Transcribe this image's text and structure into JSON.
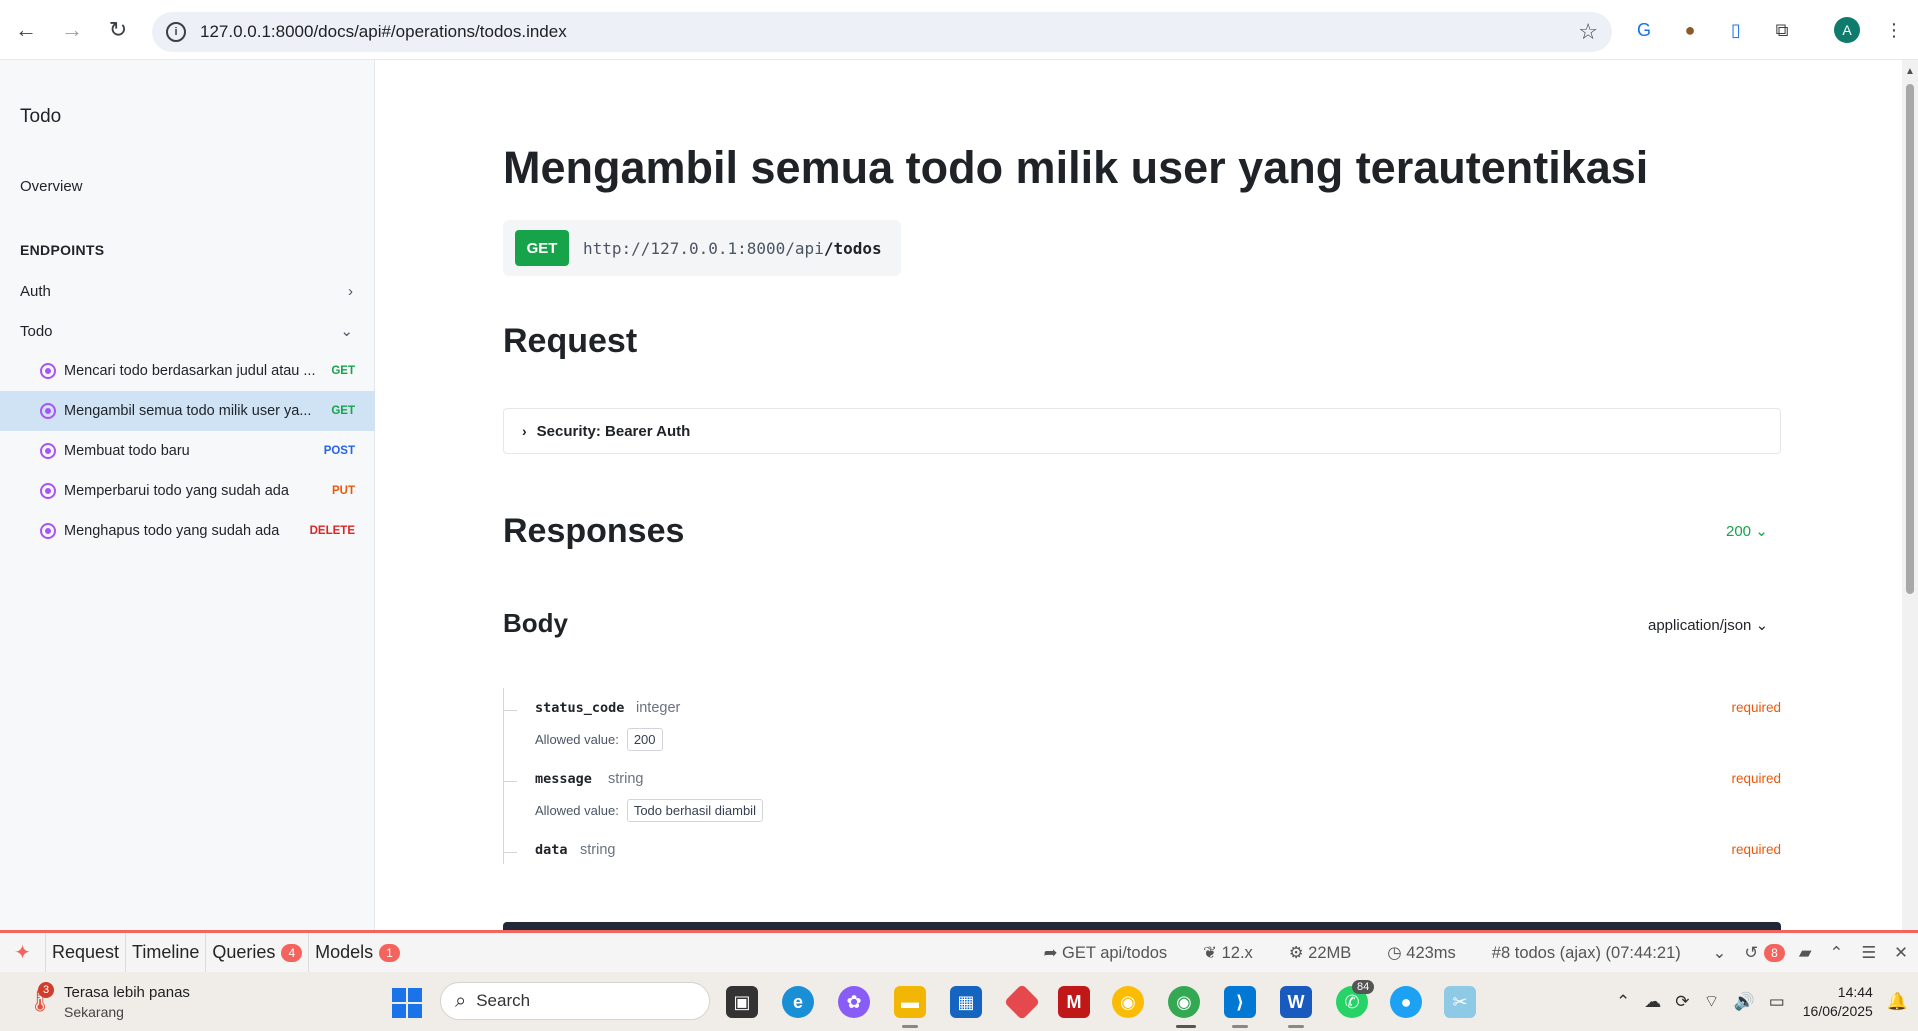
{
  "browser": {
    "url": "127.0.0.1:8000/docs/api#/operations/todos.index",
    "profile_initial": "A"
  },
  "sidebar": {
    "title": "Todo",
    "overview": "Overview",
    "section_label": "ENDPOINTS",
    "groups": [
      {
        "label": "Auth",
        "expanded": false
      },
      {
        "label": "Todo",
        "expanded": true
      }
    ],
    "endpoints": [
      {
        "label": "Mencari todo berdasarkan judul atau ...",
        "method": "GET"
      },
      {
        "label": "Mengambil semua todo milik user ya...",
        "method": "GET",
        "active": true
      },
      {
        "label": "Membuat todo baru",
        "method": "POST"
      },
      {
        "label": "Memperbarui todo yang sudah ada",
        "method": "PUT"
      },
      {
        "label": "Menghapus todo yang sudah ada",
        "method": "DELETE"
      }
    ]
  },
  "main": {
    "title": "Mengambil semua todo milik user yang terautentikasi",
    "method": "GET",
    "url_base": "http://127.0.0.1:8000/api",
    "url_path": "/todos",
    "request_heading": "Request",
    "security_label": "Security: Bearer Auth",
    "responses_heading": "Responses",
    "status_code": "200",
    "body_heading": "Body",
    "content_type": "application/json",
    "allowed_label": "Allowed value:",
    "fields": [
      {
        "name": "status_code",
        "type": "integer",
        "required": "required",
        "allowed": "200"
      },
      {
        "name": "message",
        "type": "string",
        "required": "required",
        "allowed": "Todo berhasil diambil"
      },
      {
        "name": "data",
        "type": "string",
        "required": "required"
      }
    ]
  },
  "debugbar": {
    "tabs": [
      {
        "label": "Request"
      },
      {
        "label": "Timeline"
      },
      {
        "label": "Queries",
        "count": "4"
      },
      {
        "label": "Models",
        "count": "1"
      }
    ],
    "route": "GET api/todos",
    "version": "12.x",
    "memory": "22MB",
    "duration": "423ms",
    "request_info": "#8 todos (ajax) (07:44:21)",
    "history_count": "8"
  },
  "taskbar": {
    "weather_badge": "3",
    "weather_title": "Terasa lebih panas",
    "weather_sub": "Sekarang",
    "search_placeholder": "Search",
    "whatsapp_badge": "84",
    "time": "14:44",
    "date": "16/06/2025"
  }
}
